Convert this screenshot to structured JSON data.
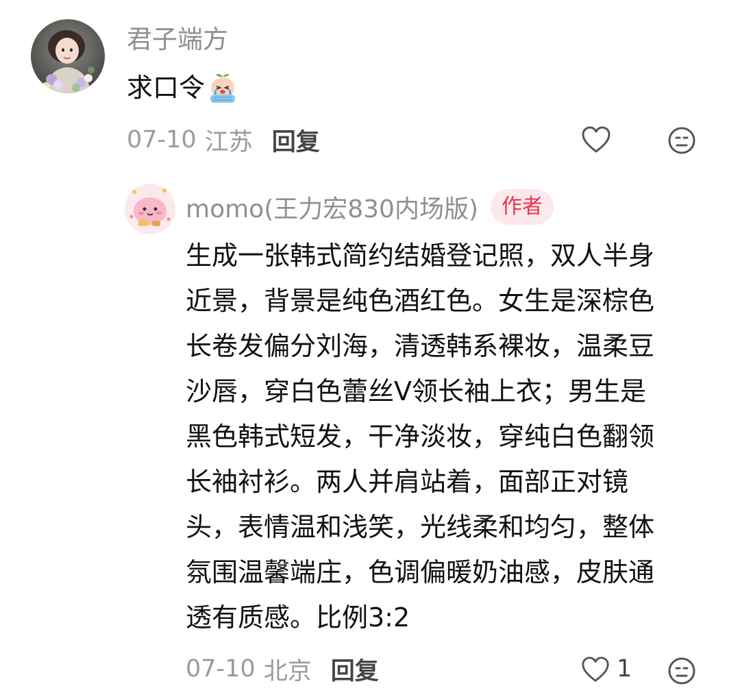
{
  "comment": {
    "username": "君子端方",
    "text": "求口令",
    "emoji": "crying-face-emoji",
    "date": "07-10",
    "location": "江苏",
    "reply_label": "回复",
    "like_icon": "heart-outline-icon",
    "dislike_icon": "unhappy-face-icon"
  },
  "reply": {
    "username": "momo(王力宏830内场版)",
    "badge": "作者",
    "text_lines": [
      "生成一张韩式简约结婚登记照，双人半身",
      "近景，背景是纯色酒红色。女生是深棕色",
      "长卷发偏分刘海，清透韩系裸妆，温柔豆",
      "沙唇，穿白色蕾丝V领长袖上衣；男生是",
      "黑色韩式短发，干净淡妆，穿纯白色翻领",
      "长袖衬衫。两人并肩站着，面部正对镜",
      "头，表情温和浅笑，光线柔和均匀，整体",
      "氛围温馨端庄，色调偏暖奶油感，皮肤通",
      "透有质感。比例3:2"
    ],
    "date": "07-10",
    "location": "北京",
    "reply_label": "回复",
    "like_count": "1",
    "like_icon": "heart-outline-icon",
    "dislike_icon": "unhappy-face-icon"
  },
  "colors": {
    "username": "#8f8f8f",
    "meta": "#9a9a9a",
    "badge_bg": "#fde8ec",
    "badge_text": "#e8344f"
  }
}
